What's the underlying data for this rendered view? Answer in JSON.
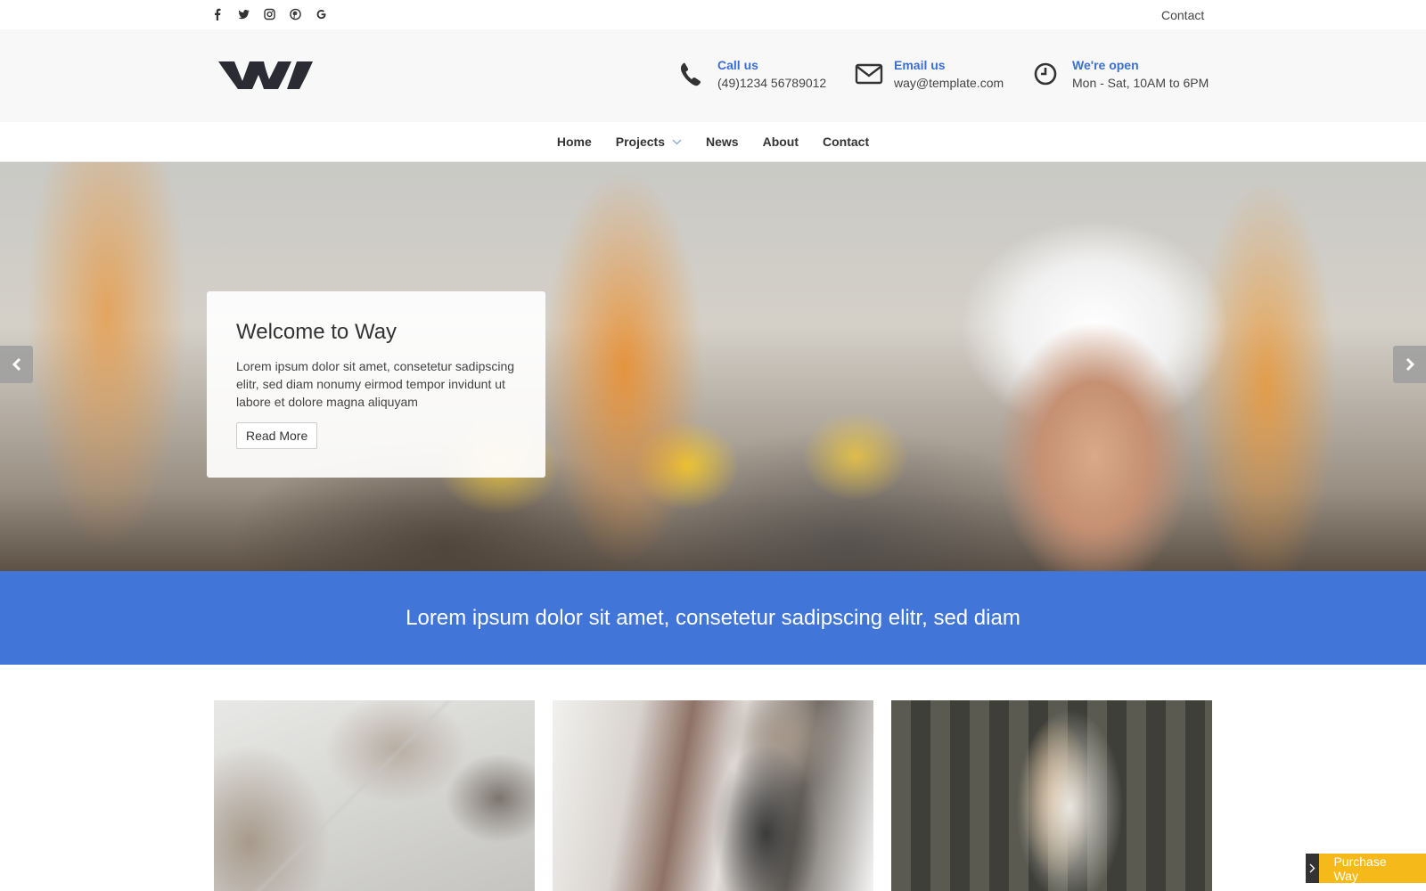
{
  "topbar": {
    "social_icons": [
      "facebook-icon",
      "twitter-icon",
      "instagram-icon",
      "pinterest-icon",
      "google-icon"
    ],
    "contact_label": "Contact"
  },
  "header": {
    "logo": "W",
    "call": {
      "label": "Call us",
      "value": "(49)1234 56789012",
      "icon": "phone-icon"
    },
    "email": {
      "label": "Email us",
      "value": "way@template.com",
      "icon": "envelope-icon"
    },
    "hours": {
      "label": "We're open",
      "value": "Mon - Sat, 10AM to 6PM",
      "icon": "clock-icon"
    }
  },
  "nav": {
    "items": [
      {
        "label": "Home"
      },
      {
        "label": "Projects",
        "has_dropdown": true
      },
      {
        "label": "News"
      },
      {
        "label": "About"
      },
      {
        "label": "Contact"
      }
    ]
  },
  "hero": {
    "title": "Welcome to Way",
    "text": "Lorem ipsum dolor sit amet, consetetur sadipscing elitr, sed diam nonumy eirmod tempor invidunt ut labore et dolore magna aliquyam",
    "button_label": "Read More"
  },
  "banner": {
    "text": "Lorem ipsum dolor sit amet, consetetur sadipscing elitr, sed diam"
  },
  "purchase": {
    "label": "Purchase Way"
  },
  "colors": {
    "accent": "#4176d8",
    "link": "#3b6fd1",
    "purchase": "#f5b91a"
  }
}
